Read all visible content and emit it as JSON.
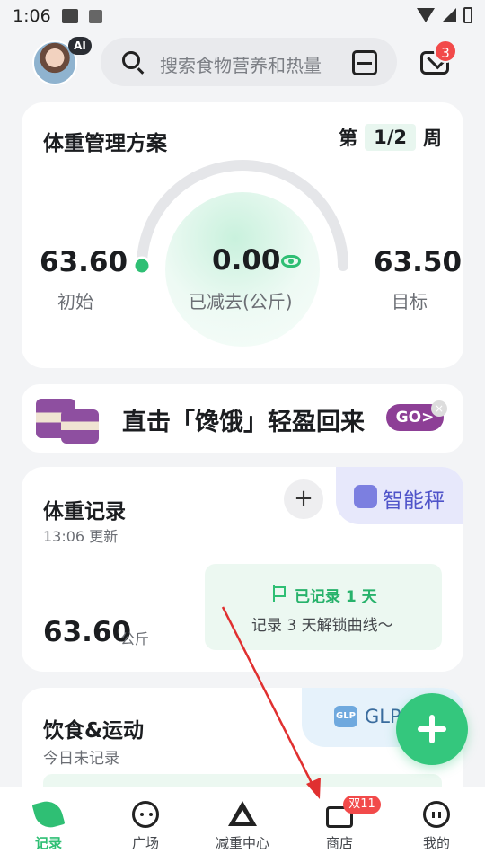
{
  "status_bar": {
    "time": "1:06"
  },
  "header": {
    "ai_badge": "AI",
    "search_placeholder": "搜索食物营养和热量",
    "mail_badge_count": "3"
  },
  "plan": {
    "title": "体重管理方案",
    "week_prefix": "第",
    "week_value": "1/2",
    "week_suffix": "周",
    "initial_value": "63.60",
    "initial_label": "初始",
    "lost_value": "0.00",
    "lost_label": "已减去(公斤)",
    "target_value": "63.50",
    "target_label": "目标"
  },
  "banner": {
    "text": "直击「馋饿」轻盈回来",
    "go_label": "GO>"
  },
  "weight_record": {
    "title": "体重记录",
    "updated": "13:06 更新",
    "value": "63.60",
    "unit": "公斤",
    "add_label": "+",
    "scale_label": "智能秤",
    "recorded_label": "已记录 1 天",
    "tip": "记录 3 天解锁曲线～"
  },
  "diet": {
    "title": "饮食&运动",
    "subtitle": "今日未记录",
    "glp_label": "GLP",
    "glp_icon_text": "GLP"
  },
  "bottom_nav": {
    "items": [
      {
        "label": "记录"
      },
      {
        "label": "广场"
      },
      {
        "label": "减重中心"
      },
      {
        "label": "商店"
      },
      {
        "label": "我的"
      }
    ],
    "shop_badge": "双11"
  },
  "colors": {
    "accent_green": "#2fbf74",
    "badge_red": "#f24a4a",
    "purple": "#8d3f96"
  }
}
